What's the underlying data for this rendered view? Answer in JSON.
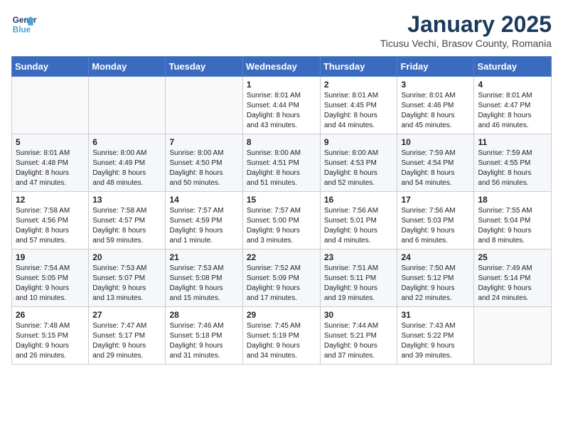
{
  "header": {
    "logo_line1": "General",
    "logo_line2": "Blue",
    "month": "January 2025",
    "location": "Ticusu Vechi, Brasov County, Romania"
  },
  "weekdays": [
    "Sunday",
    "Monday",
    "Tuesday",
    "Wednesday",
    "Thursday",
    "Friday",
    "Saturday"
  ],
  "weeks": [
    [
      {
        "day": "",
        "info": ""
      },
      {
        "day": "",
        "info": ""
      },
      {
        "day": "",
        "info": ""
      },
      {
        "day": "1",
        "info": "Sunrise: 8:01 AM\nSunset: 4:44 PM\nDaylight: 8 hours\nand 43 minutes."
      },
      {
        "day": "2",
        "info": "Sunrise: 8:01 AM\nSunset: 4:45 PM\nDaylight: 8 hours\nand 44 minutes."
      },
      {
        "day": "3",
        "info": "Sunrise: 8:01 AM\nSunset: 4:46 PM\nDaylight: 8 hours\nand 45 minutes."
      },
      {
        "day": "4",
        "info": "Sunrise: 8:01 AM\nSunset: 4:47 PM\nDaylight: 8 hours\nand 46 minutes."
      }
    ],
    [
      {
        "day": "5",
        "info": "Sunrise: 8:01 AM\nSunset: 4:48 PM\nDaylight: 8 hours\nand 47 minutes."
      },
      {
        "day": "6",
        "info": "Sunrise: 8:00 AM\nSunset: 4:49 PM\nDaylight: 8 hours\nand 48 minutes."
      },
      {
        "day": "7",
        "info": "Sunrise: 8:00 AM\nSunset: 4:50 PM\nDaylight: 8 hours\nand 50 minutes."
      },
      {
        "day": "8",
        "info": "Sunrise: 8:00 AM\nSunset: 4:51 PM\nDaylight: 8 hours\nand 51 minutes."
      },
      {
        "day": "9",
        "info": "Sunrise: 8:00 AM\nSunset: 4:53 PM\nDaylight: 8 hours\nand 52 minutes."
      },
      {
        "day": "10",
        "info": "Sunrise: 7:59 AM\nSunset: 4:54 PM\nDaylight: 8 hours\nand 54 minutes."
      },
      {
        "day": "11",
        "info": "Sunrise: 7:59 AM\nSunset: 4:55 PM\nDaylight: 8 hours\nand 56 minutes."
      }
    ],
    [
      {
        "day": "12",
        "info": "Sunrise: 7:58 AM\nSunset: 4:56 PM\nDaylight: 8 hours\nand 57 minutes."
      },
      {
        "day": "13",
        "info": "Sunrise: 7:58 AM\nSunset: 4:57 PM\nDaylight: 8 hours\nand 59 minutes."
      },
      {
        "day": "14",
        "info": "Sunrise: 7:57 AM\nSunset: 4:59 PM\nDaylight: 9 hours\nand 1 minute."
      },
      {
        "day": "15",
        "info": "Sunrise: 7:57 AM\nSunset: 5:00 PM\nDaylight: 9 hours\nand 3 minutes."
      },
      {
        "day": "16",
        "info": "Sunrise: 7:56 AM\nSunset: 5:01 PM\nDaylight: 9 hours\nand 4 minutes."
      },
      {
        "day": "17",
        "info": "Sunrise: 7:56 AM\nSunset: 5:03 PM\nDaylight: 9 hours\nand 6 minutes."
      },
      {
        "day": "18",
        "info": "Sunrise: 7:55 AM\nSunset: 5:04 PM\nDaylight: 9 hours\nand 8 minutes."
      }
    ],
    [
      {
        "day": "19",
        "info": "Sunrise: 7:54 AM\nSunset: 5:05 PM\nDaylight: 9 hours\nand 10 minutes."
      },
      {
        "day": "20",
        "info": "Sunrise: 7:53 AM\nSunset: 5:07 PM\nDaylight: 9 hours\nand 13 minutes."
      },
      {
        "day": "21",
        "info": "Sunrise: 7:53 AM\nSunset: 5:08 PM\nDaylight: 9 hours\nand 15 minutes."
      },
      {
        "day": "22",
        "info": "Sunrise: 7:52 AM\nSunset: 5:09 PM\nDaylight: 9 hours\nand 17 minutes."
      },
      {
        "day": "23",
        "info": "Sunrise: 7:51 AM\nSunset: 5:11 PM\nDaylight: 9 hours\nand 19 minutes."
      },
      {
        "day": "24",
        "info": "Sunrise: 7:50 AM\nSunset: 5:12 PM\nDaylight: 9 hours\nand 22 minutes."
      },
      {
        "day": "25",
        "info": "Sunrise: 7:49 AM\nSunset: 5:14 PM\nDaylight: 9 hours\nand 24 minutes."
      }
    ],
    [
      {
        "day": "26",
        "info": "Sunrise: 7:48 AM\nSunset: 5:15 PM\nDaylight: 9 hours\nand 26 minutes."
      },
      {
        "day": "27",
        "info": "Sunrise: 7:47 AM\nSunset: 5:17 PM\nDaylight: 9 hours\nand 29 minutes."
      },
      {
        "day": "28",
        "info": "Sunrise: 7:46 AM\nSunset: 5:18 PM\nDaylight: 9 hours\nand 31 minutes."
      },
      {
        "day": "29",
        "info": "Sunrise: 7:45 AM\nSunset: 5:19 PM\nDaylight: 9 hours\nand 34 minutes."
      },
      {
        "day": "30",
        "info": "Sunrise: 7:44 AM\nSunset: 5:21 PM\nDaylight: 9 hours\nand 37 minutes."
      },
      {
        "day": "31",
        "info": "Sunrise: 7:43 AM\nSunset: 5:22 PM\nDaylight: 9 hours\nand 39 minutes."
      },
      {
        "day": "",
        "info": ""
      }
    ]
  ]
}
